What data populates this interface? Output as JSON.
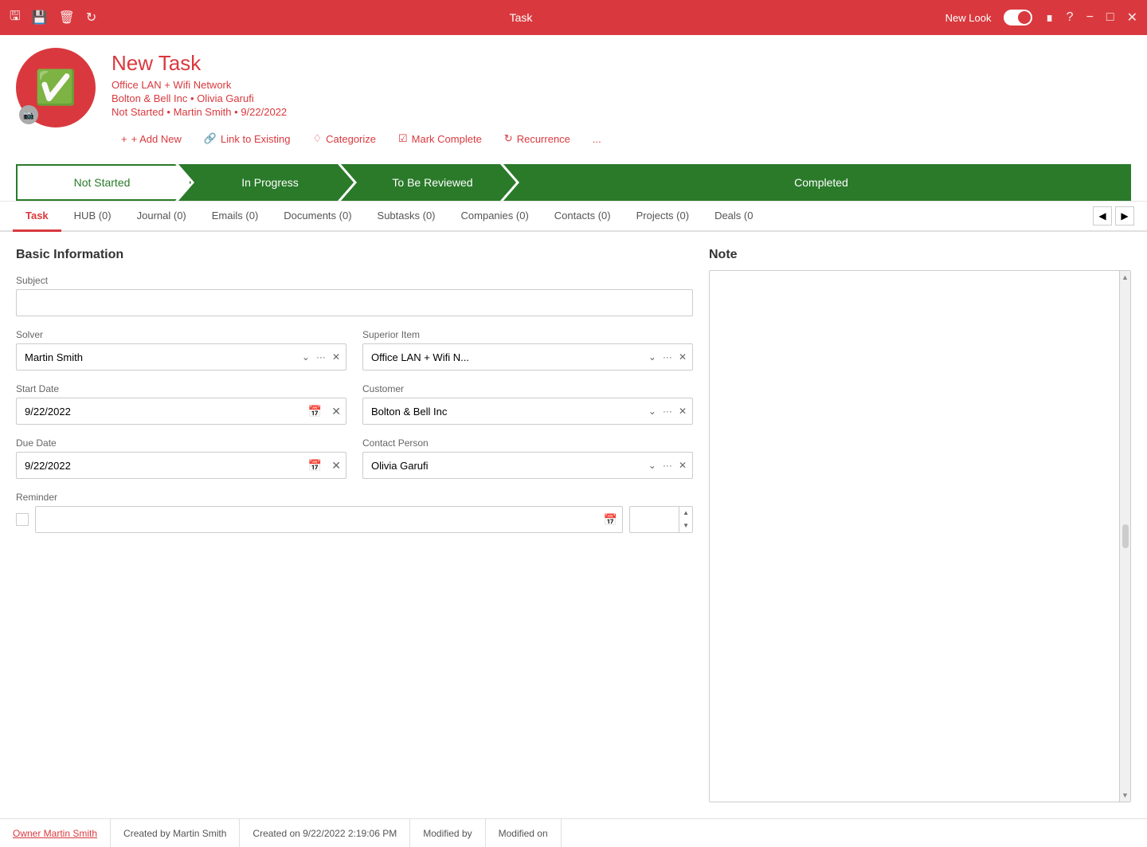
{
  "titlebar": {
    "title": "Task",
    "new_look_label": "New Look",
    "icons": [
      "save-icon",
      "save-as-icon",
      "delete-icon",
      "refresh-icon"
    ]
  },
  "header": {
    "title": "New Task",
    "project": "Office LAN + Wifi Network",
    "company": "Bolton & Bell Inc",
    "contact": "Olivia Garufi",
    "status": "Not Started",
    "owner": "Martin Smith",
    "date": "9/22/2022",
    "toolbar": {
      "add_new": "+ Add New",
      "link_existing": "Link to Existing",
      "categorize": "Categorize",
      "mark_complete": "Mark Complete",
      "recurrence": "Recurrence",
      "more": "..."
    }
  },
  "status_steps": [
    {
      "id": "not-started",
      "label": "Not Started",
      "state": "not-started"
    },
    {
      "id": "in-progress",
      "label": "In Progress",
      "state": "in-progress"
    },
    {
      "id": "to-be-reviewed",
      "label": "To Be Reviewed",
      "state": "to-be-reviewed"
    },
    {
      "id": "completed",
      "label": "Completed",
      "state": "completed"
    }
  ],
  "tabs": [
    {
      "id": "task",
      "label": "Task",
      "count": null,
      "active": true
    },
    {
      "id": "hub",
      "label": "HUB (0)",
      "count": 0
    },
    {
      "id": "journal",
      "label": "Journal (0)",
      "count": 0
    },
    {
      "id": "emails",
      "label": "Emails (0)",
      "count": 0
    },
    {
      "id": "documents",
      "label": "Documents (0)",
      "count": 0
    },
    {
      "id": "subtasks",
      "label": "Subtasks (0)",
      "count": 0
    },
    {
      "id": "companies",
      "label": "Companies (0)",
      "count": 0
    },
    {
      "id": "contacts",
      "label": "Contacts (0)",
      "count": 0
    },
    {
      "id": "projects",
      "label": "Projects (0)",
      "count": 0
    },
    {
      "id": "deals",
      "label": "Deals (0",
      "count": 0
    }
  ],
  "form": {
    "basic_information": "Basic Information",
    "subject_label": "Subject",
    "subject_value": "",
    "solver_label": "Solver",
    "solver_value": "Martin Smith",
    "superior_item_label": "Superior Item",
    "superior_item_value": "Office LAN + Wifi N...",
    "start_date_label": "Start Date",
    "start_date_value": "9/22/2022",
    "customer_label": "Customer",
    "customer_value": "Bolton & Bell Inc",
    "due_date_label": "Due Date",
    "due_date_value": "9/22/2022",
    "contact_person_label": "Contact Person",
    "contact_person_value": "Olivia Garufi",
    "reminder_label": "Reminder"
  },
  "note": {
    "title": "Note",
    "placeholder": ""
  },
  "footer": {
    "owner_label": "Owner",
    "owner_name": "Martin Smith",
    "owner_link": "Owner Martin Smith",
    "created_by": "Created by Martin Smith",
    "created_on": "Created on 9/22/2022 2:19:06 PM",
    "modified_by": "Modified by",
    "modified_on": "Modified on"
  }
}
